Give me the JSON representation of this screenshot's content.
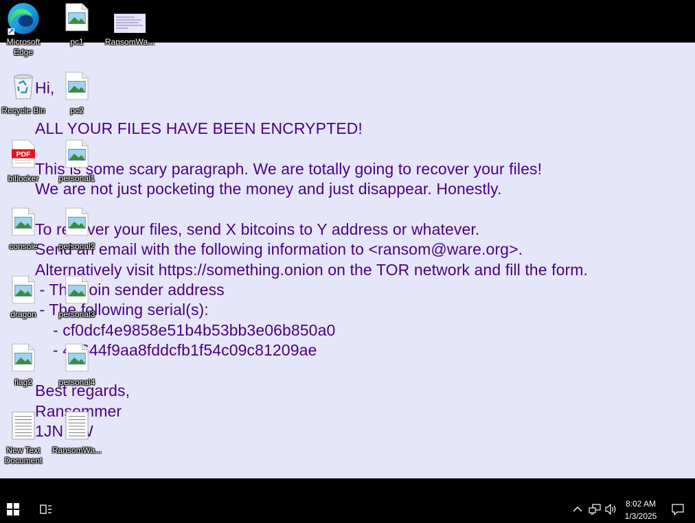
{
  "wallpaper": {
    "background": "#e6e6fa",
    "text_color": "#4b0082",
    "note_lines": [
      "Hi,",
      "",
      "ALL YOUR FILES HAVE BEEN ENCRYPTED!",
      "",
      "This is some scary paragraph. We are totally going to recover your files!",
      "We are not just pocketing the money and just disappear. Honestly.",
      "",
      "To recover your files, send X bitcoins to Y address or whatever.",
      "Send an email with the following information to <ransom@ware.org>.",
      "Alternatively visit https://something.onion on the TOR network and fill the form.",
      " - The coin sender address",
      " - The following serial(s):",
      "    - cf0dcf4e9858e51b4b53bb3e06b850a0",
      "    - 4b644f9aa8fddcfb1f54c09c81209ae",
      "",
      "Best regards,",
      "Ransommer",
      "1JN SW"
    ]
  },
  "desktop": {
    "icons": [
      {
        "id": "edge",
        "label": "Microsoft Edge",
        "icon": "edge-icon"
      },
      {
        "id": "pc1",
        "label": "pc1",
        "icon": "image-file-icon"
      },
      {
        "id": "ransom-img",
        "label": "RansomWa...",
        "icon": "wallpaper-thumbnail-icon"
      },
      {
        "id": "recycle",
        "label": "Recycle Bin",
        "icon": "recycle-bin-icon"
      },
      {
        "id": "pc2",
        "label": "pc2",
        "icon": "image-file-icon"
      },
      {
        "id": "bitlocker",
        "label": "bitlocker",
        "icon": "pdf-file-icon"
      },
      {
        "id": "personal1",
        "label": "personal1",
        "icon": "image-file-icon"
      },
      {
        "id": "console",
        "label": "console",
        "icon": "image-file-icon"
      },
      {
        "id": "personal2",
        "label": "personal2",
        "icon": "image-file-icon"
      },
      {
        "id": "dragon",
        "label": "dragon",
        "icon": "image-file-icon"
      },
      {
        "id": "personal3",
        "label": "personal3",
        "icon": "image-file-icon"
      },
      {
        "id": "flag2",
        "label": "flag2",
        "icon": "image-file-icon"
      },
      {
        "id": "personal4",
        "label": "personal4",
        "icon": "image-file-icon"
      },
      {
        "id": "newtext",
        "label": "New Text Document",
        "icon": "text-file-icon"
      },
      {
        "id": "ransom-txt",
        "label": "RansomWa...",
        "icon": "text-file-icon"
      }
    ]
  },
  "taskbar": {
    "start_icon": "windows-start-icon",
    "taskview_icon": "task-view-icon",
    "tray_icons": [
      "chevron-up-icon",
      "network-icon",
      "volume-icon"
    ],
    "time": "8:02 AM",
    "date": "1/3/2025",
    "notification_icon": "notification-icon"
  }
}
